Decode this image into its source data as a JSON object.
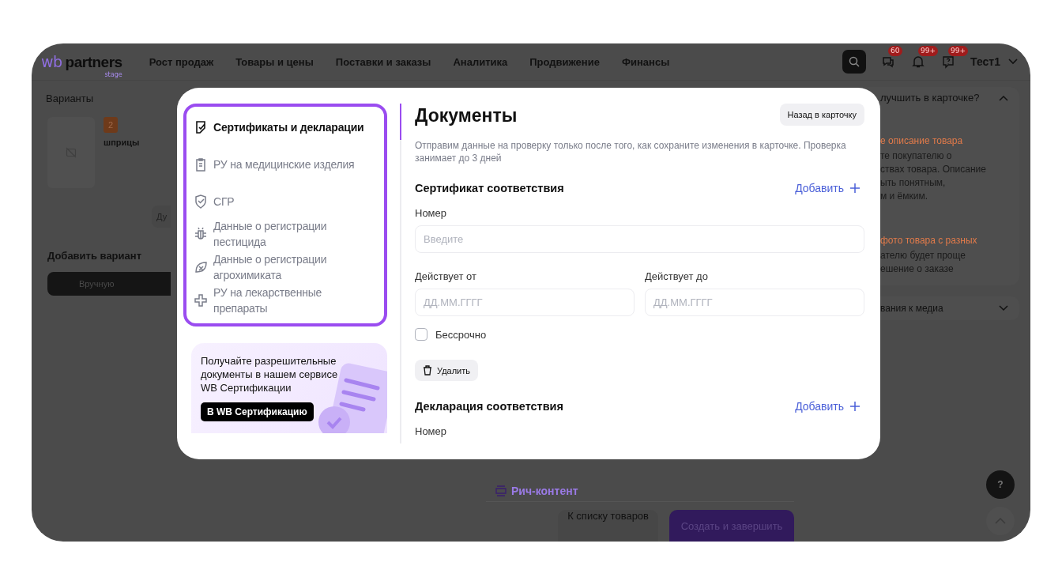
{
  "header": {
    "logo": "wb",
    "logo_word": "partners",
    "logo_tag": "stage",
    "nav": [
      "Рост продаж",
      "Товары и цены",
      "Поставки и заказы",
      "Аналитика",
      "Продвижение",
      "Финансы"
    ],
    "notifications": [
      {
        "kind": "chat",
        "badge": "60"
      },
      {
        "kind": "bell",
        "badge": "99+"
      },
      {
        "kind": "help",
        "badge": "99+"
      }
    ],
    "user": "Тест1"
  },
  "variants_panel": {
    "title": "Варианты",
    "variant": {
      "badge": "2",
      "name": "шприцы"
    },
    "cut_button": "Ду",
    "add_title": "Добавить вариант",
    "manual_button": "Вручную"
  },
  "content_footer": {
    "rich_content": "Рич-контент",
    "buttons": [
      {
        "label": "К списку товаров",
        "kind": "secondary"
      },
      {
        "label": "Создать и завершить",
        "kind": "primary"
      }
    ]
  },
  "tips_panel": {
    "title": "лучшить в карточке?",
    "expanded": true,
    "tips": [
      {
        "title": "е описание товара",
        "lines": [
          "те покупателю о",
          "ствах товара. Описание",
          "ыть понятным,",
          "м и ёмким."
        ]
      },
      {
        "title": "фото товара с разных",
        "lines": [
          "ателю будет проще",
          "ешение о заказе"
        ]
      }
    ],
    "media": {
      "title": "вания к медиа",
      "expanded": false
    }
  },
  "help_button": "?",
  "modal": {
    "nav": [
      {
        "label": "Сертификаты и декларации",
        "selected": true
      },
      {
        "label": "РУ на медицинские изделия",
        "selected": false
      },
      {
        "label": "СГР",
        "selected": false
      },
      {
        "label": "Данные о регистрации пестицида",
        "selected": false
      },
      {
        "label": "Данные о регистрации агрохимиката",
        "selected": false
      },
      {
        "label": "РУ на лекарственные препараты",
        "selected": false
      }
    ],
    "promo": {
      "text": "Получайте разрешительные документы в нашем сервисе WB Сертификации",
      "button": "В WB Сертификацию"
    },
    "title": "Документы",
    "back_button": "Назад в карточку",
    "note": "Отправим данные на проверку только после того, как сохраните изменения в карточке. Проверка занимает до 3 дней",
    "sections": [
      {
        "title": "Сертификат соответствия",
        "add": "Добавить",
        "number_label": "Номер",
        "number_placeholder": "Введите",
        "from_label": "Действует от",
        "from_placeholder": "ДД.ММ.ГГГГ",
        "to_label": "Действует до",
        "to_placeholder": "ДД.ММ.ГГГГ",
        "unlimited": {
          "label": "Бессрочно",
          "checked": false
        },
        "delete": "Удалить"
      },
      {
        "title": "Декларация соответствия",
        "add": "Добавить",
        "number_label": "Номер"
      }
    ]
  }
}
